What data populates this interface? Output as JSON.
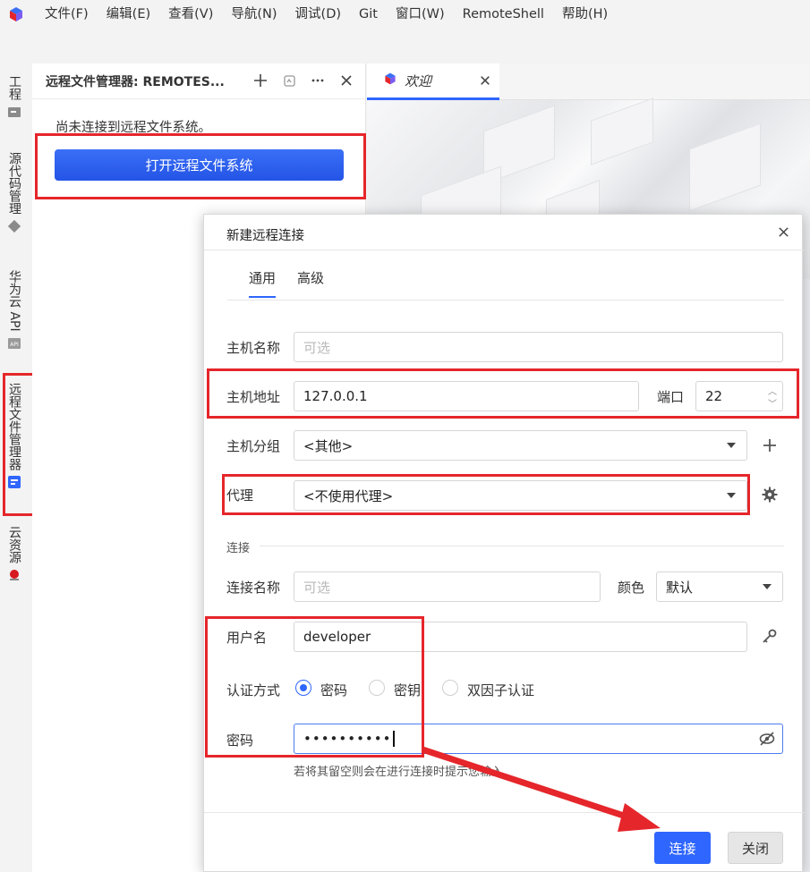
{
  "menu": [
    "文件(F)",
    "编辑(E)",
    "查看(V)",
    "导航(N)",
    "调试(D)",
    "Git",
    "窗口(W)",
    "RemoteShell",
    "帮助(H)"
  ],
  "activity": {
    "project": "工程",
    "source_control": "源代码管理",
    "huawei_api": "华为云 API",
    "remote_fs": "远程文件管理器",
    "cloud": "云资源"
  },
  "panel": {
    "title": "远程文件管理器: REMOTES...",
    "message": "尚未连接到远程文件系统。",
    "open_button": "打开远程文件系统"
  },
  "editor": {
    "tab_label": "欢迎"
  },
  "dialog": {
    "title": "新建远程连接",
    "tabs": [
      "通用",
      "高级"
    ],
    "host_name": {
      "label": "主机名称",
      "placeholder": "可选"
    },
    "host_address": {
      "label": "主机地址",
      "value": "127.0.0.1"
    },
    "port": {
      "label": "端口",
      "value": "22"
    },
    "host_group": {
      "label": "主机分组",
      "value": "<其他>"
    },
    "proxy": {
      "label": "代理",
      "value": "<不使用代理>"
    },
    "section_connection": "连接",
    "connection_name": {
      "label": "连接名称",
      "placeholder": "可选"
    },
    "color": {
      "label": "颜色",
      "value": "默认"
    },
    "username": {
      "label": "用户名",
      "value": "developer"
    },
    "auth": {
      "label": "认证方式",
      "options": [
        "密码",
        "密钥",
        "双因子认证"
      ],
      "selected": "密码"
    },
    "password": {
      "label": "密码",
      "value": "••••••••••"
    },
    "hint": "若将其留空则会在进行连接时提示您输入",
    "connect_button": "连接",
    "close_button": "关闭"
  },
  "colors": {
    "accent": "#2f66ff",
    "annotation": "#e5262b"
  }
}
